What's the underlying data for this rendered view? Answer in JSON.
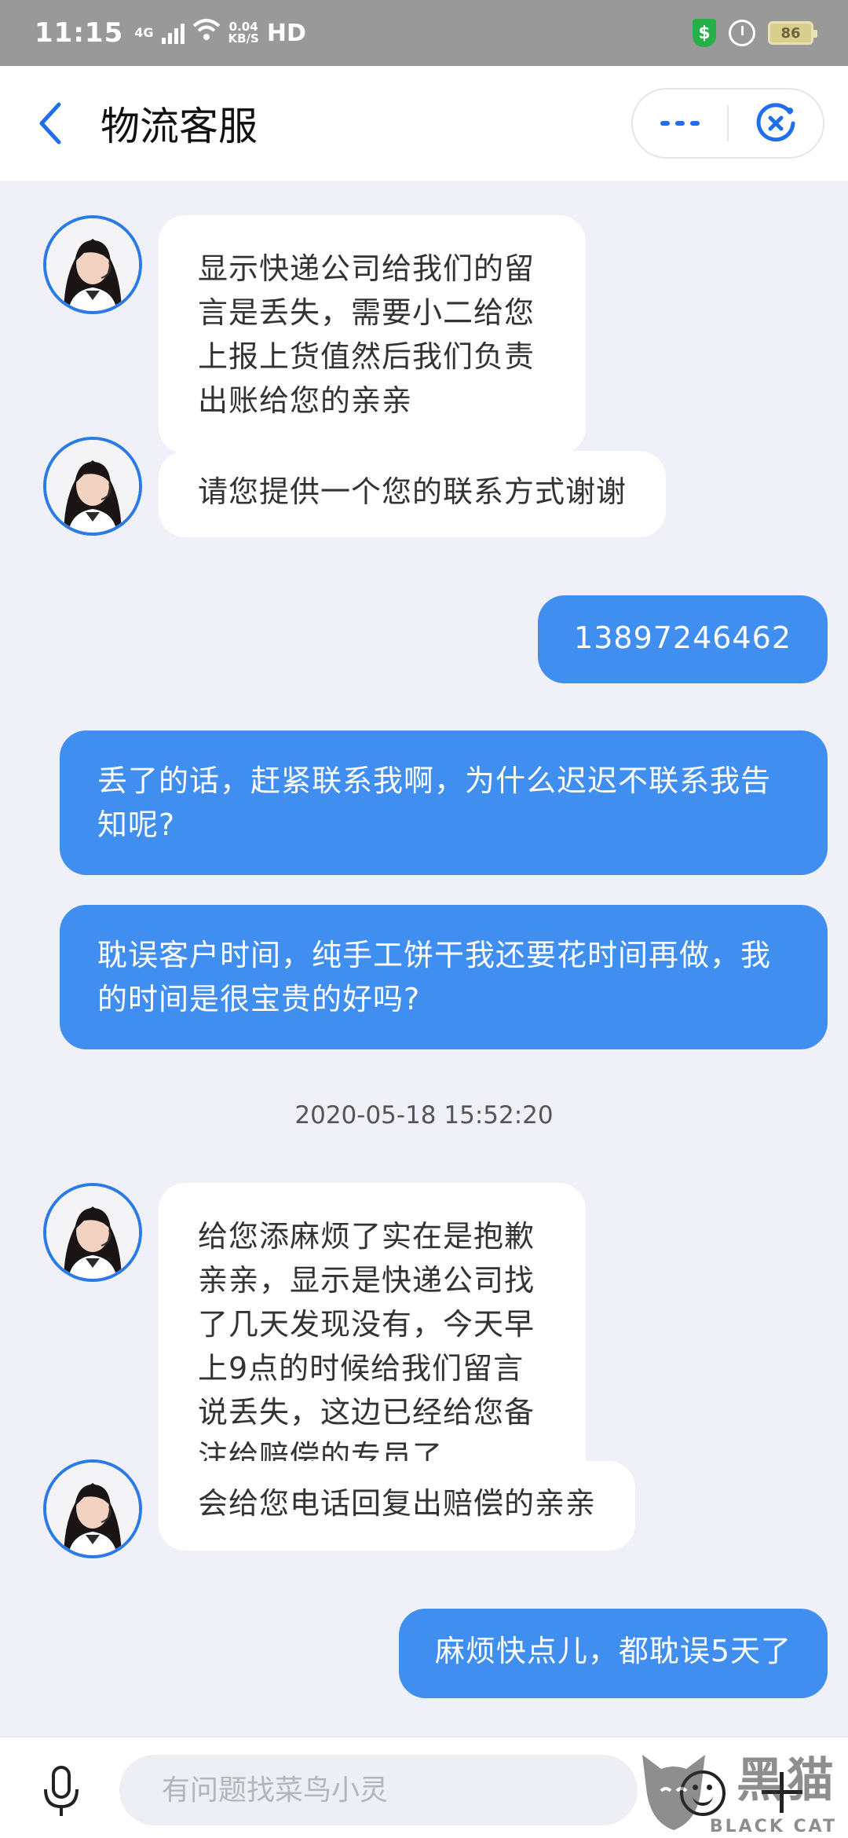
{
  "status_bar": {
    "time": "11:15",
    "network": "4G",
    "speed_value": "0.04",
    "speed_unit": "KB/S",
    "hd": "HD",
    "battery": "86",
    "icons": [
      "signal-icon",
      "wifi-icon",
      "shield-dollar-icon",
      "alarm-icon",
      "battery-icon"
    ]
  },
  "header": {
    "title": "物流客服",
    "accent": "#1f6feb"
  },
  "messages": [
    {
      "side": "left",
      "text": "显示快递公司给我们的留言是丢失，需要小二给您上报上货值然后我们负责出账给您的亲亲"
    },
    {
      "side": "left",
      "text": "请您提供一个您的联系方式谢谢"
    },
    {
      "side": "right",
      "text": "13897246462"
    },
    {
      "side": "right",
      "text": "丢了的话，赶紧联系我啊，为什么迟迟不联系我告知呢?"
    },
    {
      "side": "right",
      "text": "耽误客户时间，纯手工饼干我还要花时间再做，我的时间是很宝贵的好吗?"
    },
    {
      "side": "left",
      "text": "给您添麻烦了实在是抱歉亲亲，显示是快递公司找了几天发现没有，今天早上9点的时候给我们留言说丢失，这边已经给您备注给赔偿的专员了"
    },
    {
      "side": "left",
      "text": "会给您电话回复出赔偿的亲亲"
    },
    {
      "side": "right",
      "text": "麻烦快点儿，都耽误5天了"
    }
  ],
  "timestamp": "2020-05-18 15:52:20",
  "input": {
    "placeholder": "有问题找菜鸟小灵"
  },
  "watermark": {
    "cn": "黑猫",
    "en": "BLACK CAT"
  },
  "colors": {
    "outgoing_bubble": "#3f8ef0",
    "incoming_bubble": "#ffffff",
    "background": "#f0f1f8"
  }
}
